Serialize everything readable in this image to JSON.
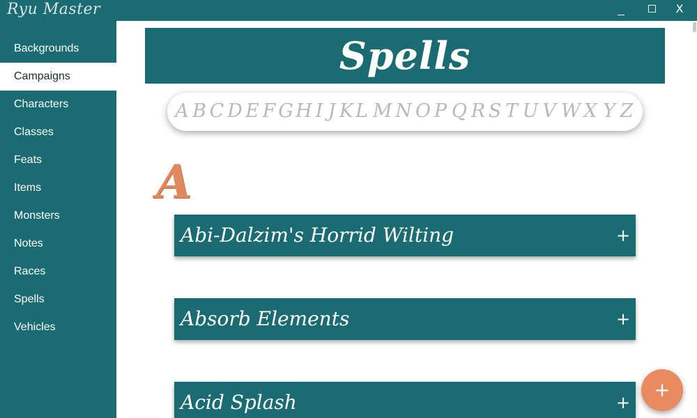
{
  "app": {
    "title": "Ryu Master",
    "window_controls": {
      "minimize": "minimize-icon",
      "maximize": "maximize-icon",
      "close": "X"
    }
  },
  "sidebar": {
    "items": [
      {
        "label": "Backgrounds",
        "active": false
      },
      {
        "label": "Campaigns",
        "active": true
      },
      {
        "label": "Characters",
        "active": false
      },
      {
        "label": "Classes",
        "active": false
      },
      {
        "label": "Feats",
        "active": false
      },
      {
        "label": "Items",
        "active": false
      },
      {
        "label": "Monsters",
        "active": false
      },
      {
        "label": "Notes",
        "active": false
      },
      {
        "label": "Races",
        "active": false
      },
      {
        "label": "Spells",
        "active": false
      },
      {
        "label": "Vehicles",
        "active": false
      }
    ]
  },
  "main": {
    "title": "Spells",
    "alphabet": [
      "A",
      "B",
      "C",
      "D",
      "E",
      "F",
      "G",
      "H",
      "I",
      "J",
      "K",
      "L",
      "M",
      "N",
      "O",
      "P",
      "Q",
      "R",
      "S",
      "T",
      "U",
      "V",
      "W",
      "X",
      "Y",
      "Z"
    ],
    "section_letter": "A",
    "spells": [
      {
        "name": "Abi-Dalzim's Horrid Wilting",
        "expand_icon": "+"
      },
      {
        "name": "Absorb Elements",
        "expand_icon": "+"
      },
      {
        "name": "Acid Splash",
        "expand_icon": "+"
      }
    ]
  },
  "fab": {
    "icon": "+"
  },
  "colors": {
    "primary": "#1b6b73",
    "accent": "#e98a60",
    "alphabet_text": "#b9b9b9",
    "background": "#ffffff"
  }
}
